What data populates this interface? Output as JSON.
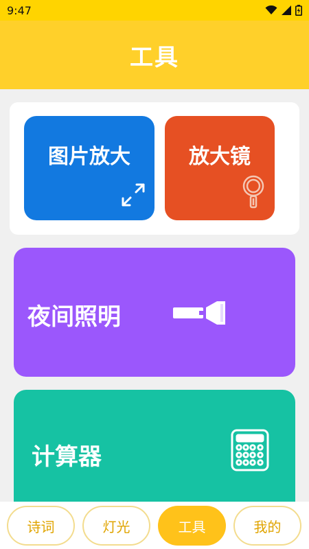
{
  "status_bar": {
    "time": "9:47",
    "icons": [
      "wifi-icon",
      "signal-icon",
      "battery-icon"
    ]
  },
  "header": {
    "title": "工具"
  },
  "tiles": {
    "zoom_image": {
      "label": "图片放大",
      "icon": "expand-icon",
      "color": "#1279e0"
    },
    "magnifier": {
      "label": "放大镜",
      "icon": "magnifier-icon",
      "color": "#e65023"
    },
    "night_light": {
      "label": "夜间照明",
      "icon": "flashlight-icon",
      "color": "#9b57fc"
    },
    "calculator": {
      "label": "计算器",
      "icon": "calculator-icon",
      "color": "#16c2a3"
    }
  },
  "bottom_nav": {
    "items": [
      {
        "label": "诗词",
        "active": false
      },
      {
        "label": "灯光",
        "active": false
      },
      {
        "label": "工具",
        "active": true
      },
      {
        "label": "我的",
        "active": false
      }
    ],
    "accent": "#ffc21a"
  },
  "colors": {
    "header_bg": "#ffd02a",
    "status_bg": "#ffd400",
    "page_bg": "#f0f0f0"
  }
}
